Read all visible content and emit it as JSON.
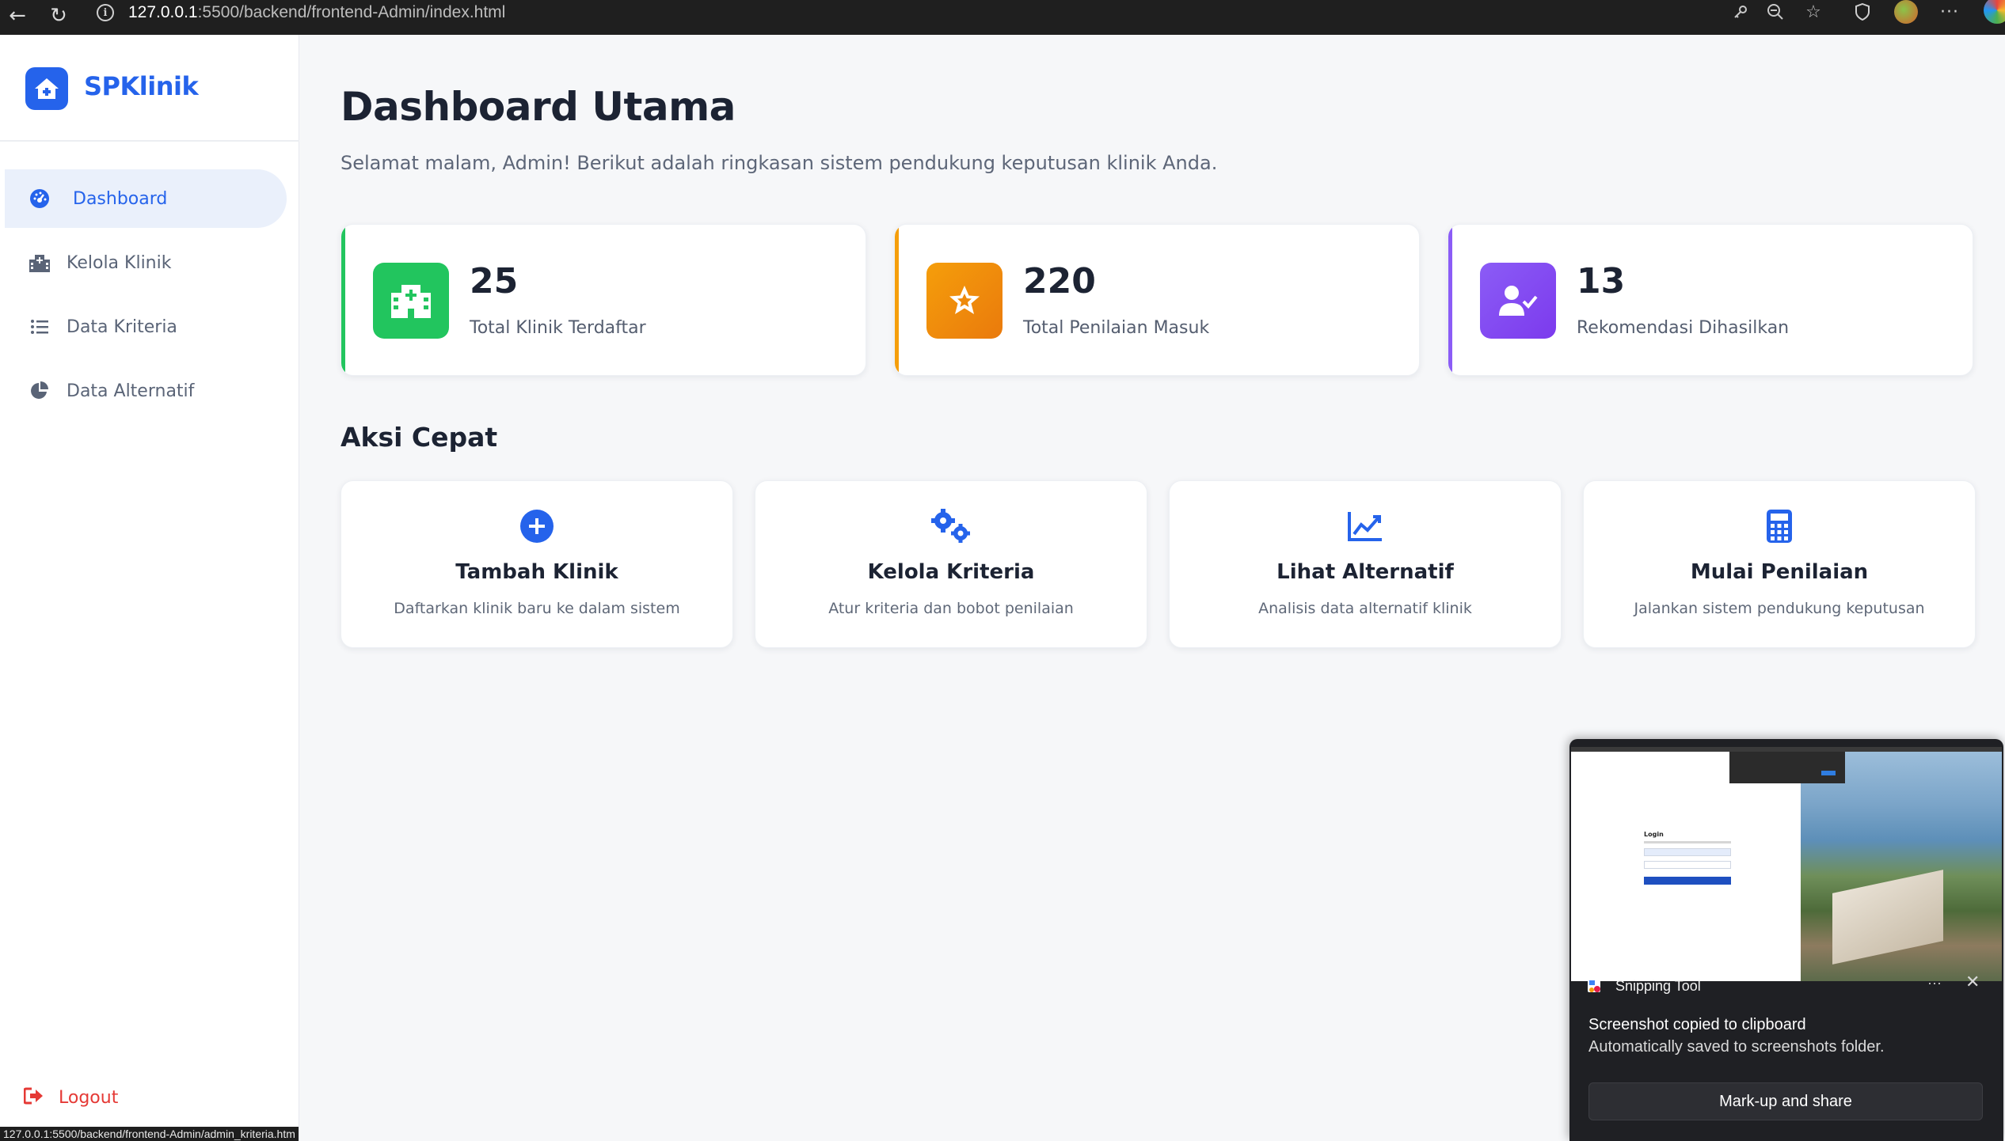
{
  "browser": {
    "url_host": "127.0.0.1",
    "url_path": ":5500/backend/frontend-Admin/index.html",
    "status_url": "127.0.0.1:5500/backend/frontend-Admin/admin_kriteria.htm"
  },
  "sidebar": {
    "brand": "SPKlinik",
    "items": [
      {
        "label": "Dashboard",
        "icon": "gauge-icon",
        "active": true
      },
      {
        "label": "Kelola Klinik",
        "icon": "hospital-icon",
        "active": false
      },
      {
        "label": "Data Kriteria",
        "icon": "list-icon",
        "active": false
      },
      {
        "label": "Data Alternatif",
        "icon": "pie-chart-icon",
        "active": false
      }
    ],
    "logout": "Logout"
  },
  "main": {
    "title": "Dashboard Utama",
    "subtitle": "Selamat malam, Admin! Berikut adalah ringkasan sistem pendukung keputusan klinik Anda.",
    "stats": [
      {
        "value": "25",
        "label": "Total Klinik Terdaftar",
        "color": "#22c55e",
        "icon": "hospital-icon"
      },
      {
        "value": "220",
        "label": "Total Penilaian Masuk",
        "color": "#f59e0b",
        "icon": "star-icon"
      },
      {
        "value": "13",
        "label": "Rekomendasi Dihasilkan",
        "color": "#8b5cf6",
        "icon": "user-check-icon"
      }
    ],
    "section_title": "Aksi Cepat",
    "quick_actions": [
      {
        "title": "Tambah Klinik",
        "desc": "Daftarkan klinik baru ke dalam sistem",
        "icon": "plus-circle-icon"
      },
      {
        "title": "Kelola Kriteria",
        "desc": "Atur kriteria dan bobot penilaian",
        "icon": "gears-icon"
      },
      {
        "title": "Lihat Alternatif",
        "desc": "Analisis data alternatif klinik",
        "icon": "line-chart-icon"
      },
      {
        "title": "Mulai Penilaian",
        "desc": "Jalankan sistem pendukung keputusan",
        "icon": "calculator-icon"
      }
    ]
  },
  "toast": {
    "app_name": "Snipping Tool",
    "title": "Screenshot copied to clipboard",
    "body": "Automatically saved to screenshots folder.",
    "action": "Mark-up and share",
    "preview_label": "Login"
  },
  "colors": {
    "primary": "#2563eb",
    "logout": "#e53935"
  }
}
